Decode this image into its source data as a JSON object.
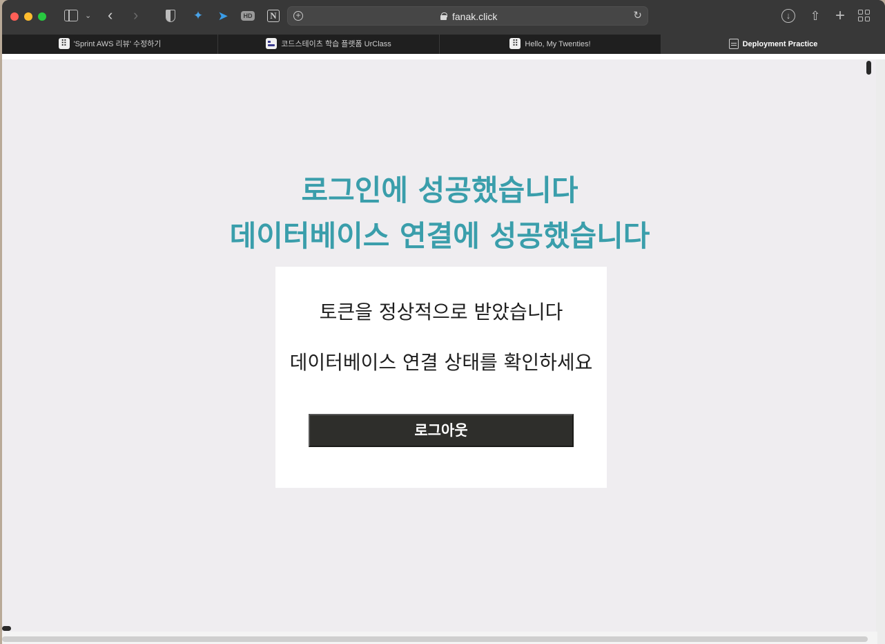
{
  "browser": {
    "url": "fanak.click",
    "tabs": [
      {
        "label": "'Sprint AWS 리뷰' 수정하기",
        "favicon": "dots-icon",
        "active": false
      },
      {
        "label": "코드스테이츠 학습 플랫폼 UrClass",
        "favicon": "codestates-icon",
        "active": false
      },
      {
        "label": "Hello, My Twenties!",
        "favicon": "dots-icon",
        "active": false
      },
      {
        "label": "Deployment Practice",
        "favicon": "page-icon",
        "active": true
      }
    ],
    "extensions": [
      "shield-icon",
      "bird-icon",
      "arrow-icon",
      "hd-icon",
      "notion-icon"
    ],
    "hd_label": "HD",
    "notion_label": "N"
  },
  "page": {
    "heading_line1": "로그인에 성공했습니다",
    "heading_line2": "데이터베이스 연결에 성공했습니다",
    "card": {
      "message1": "토큰을 정상적으로 받았습니다",
      "message2": "데이터베이스 연결 상태를 확인하세요",
      "logout_label": "로그아웃"
    }
  },
  "colors": {
    "heading": "#3a9eab",
    "page_background": "#efedf0",
    "button_background": "#2e2e2b"
  }
}
